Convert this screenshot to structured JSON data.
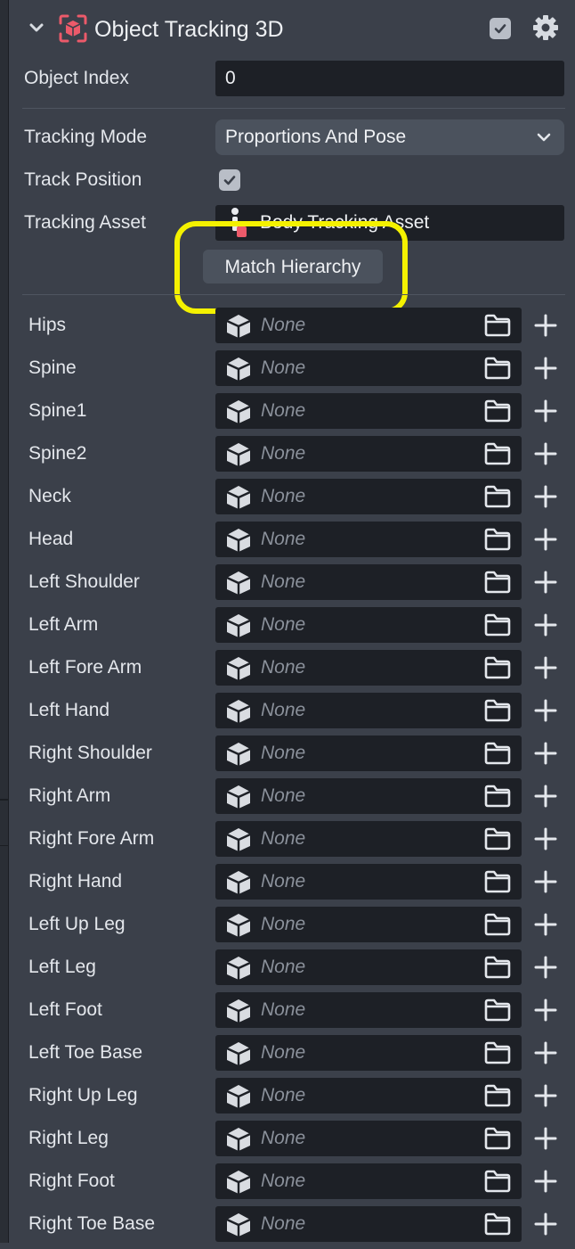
{
  "component": {
    "title": "Object Tracking 3D",
    "enabled": true
  },
  "object_index": {
    "label": "Object Index",
    "value": "0"
  },
  "tracking_mode": {
    "label": "Tracking Mode",
    "value": "Proportions And Pose"
  },
  "track_position": {
    "label": "Track Position",
    "checked": true
  },
  "tracking_asset": {
    "label": "Tracking Asset",
    "value": "Body Tracking Asset"
  },
  "match_button": {
    "label": "Match Hierarchy"
  },
  "colors": {
    "highlight": "#f4f100",
    "field_bg": "#1d2026",
    "panel_bg": "#3b404a"
  },
  "bones": [
    {
      "label": "Hips",
      "value": "None"
    },
    {
      "label": "Spine",
      "value": "None"
    },
    {
      "label": "Spine1",
      "value": "None"
    },
    {
      "label": "Spine2",
      "value": "None"
    },
    {
      "label": "Neck",
      "value": "None"
    },
    {
      "label": "Head",
      "value": "None"
    },
    {
      "label": "Left Shoulder",
      "value": "None"
    },
    {
      "label": "Left Arm",
      "value": "None"
    },
    {
      "label": "Left Fore Arm",
      "value": "None"
    },
    {
      "label": "Left Hand",
      "value": "None"
    },
    {
      "label": "Right Shoulder",
      "value": "None"
    },
    {
      "label": "Right Arm",
      "value": "None"
    },
    {
      "label": "Right Fore Arm",
      "value": "None"
    },
    {
      "label": "Right Hand",
      "value": "None"
    },
    {
      "label": "Left Up Leg",
      "value": "None"
    },
    {
      "label": "Left Leg",
      "value": "None"
    },
    {
      "label": "Left Foot",
      "value": "None"
    },
    {
      "label": "Left Toe Base",
      "value": "None"
    },
    {
      "label": "Right Up Leg",
      "value": "None"
    },
    {
      "label": "Right Leg",
      "value": "None"
    },
    {
      "label": "Right Foot",
      "value": "None"
    },
    {
      "label": "Right Toe Base",
      "value": "None"
    }
  ]
}
